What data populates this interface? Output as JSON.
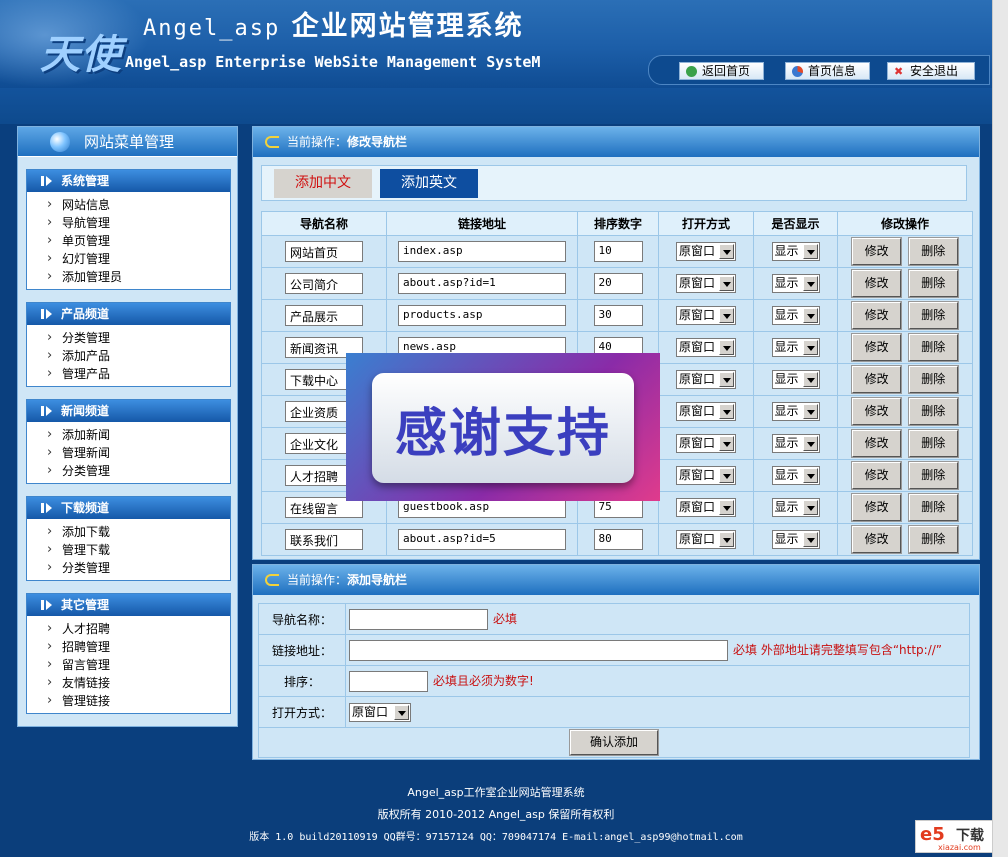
{
  "header": {
    "logo": "天使",
    "title_prefix": "Angel_asp",
    "title_main": "企业网站管理系统",
    "subtitle": "Angel_asp Enterprise WebSite Management SysteM",
    "links": [
      {
        "label": "返回首页",
        "icon": "home-icon"
      },
      {
        "label": "首页信息",
        "icon": "pie-icon"
      },
      {
        "label": "安全退出",
        "icon": "close-icon"
      }
    ]
  },
  "sidebar": {
    "title": "网站菜单管理",
    "groups": [
      {
        "title": "系统管理",
        "items": [
          "网站信息",
          "导航管理",
          "单页管理",
          "幻灯管理",
          "添加管理员"
        ]
      },
      {
        "title": "产品频道",
        "items": [
          "分类管理",
          "添加产品",
          "管理产品"
        ]
      },
      {
        "title": "新闻频道",
        "items": [
          "添加新闻",
          "管理新闻",
          "分类管理"
        ]
      },
      {
        "title": "下载频道",
        "items": [
          "添加下载",
          "管理下载",
          "分类管理"
        ]
      },
      {
        "title": "其它管理",
        "items": [
          "人才招聘",
          "招聘管理",
          "留言管理",
          "友情链接",
          "管理链接"
        ]
      }
    ]
  },
  "edit_panel": {
    "label": "当前操作：",
    "action": "修改导航栏",
    "tabs": [
      "添加中文",
      "添加英文"
    ],
    "columns": [
      "导航名称",
      "链接地址",
      "排序数字",
      "打开方式",
      "是否显示",
      "修改操作"
    ],
    "edit_label": "修改",
    "delete_label": "删除",
    "rows": [
      {
        "name": "网站首页",
        "url": "index.asp",
        "order": "10",
        "open": "原窗口",
        "show": "显示"
      },
      {
        "name": "公司简介",
        "url": "about.asp?id=1",
        "order": "20",
        "open": "原窗口",
        "show": "显示"
      },
      {
        "name": "产品展示",
        "url": "products.asp",
        "order": "30",
        "open": "原窗口",
        "show": "显示"
      },
      {
        "name": "新闻资讯",
        "url": "news.asp",
        "order": "40",
        "open": "原窗口",
        "show": "显示"
      },
      {
        "name": "下载中心",
        "url": "",
        "order": "",
        "open": "原窗口",
        "show": "显示"
      },
      {
        "name": "企业资质",
        "url": "",
        "order": "",
        "open": "原窗口",
        "show": "显示"
      },
      {
        "name": "企业文化",
        "url": "",
        "order": "",
        "open": "原窗口",
        "show": "显示"
      },
      {
        "name": "人才招聘",
        "url": "",
        "order": "",
        "open": "原窗口",
        "show": "显示"
      },
      {
        "name": "在线留言",
        "url": "guestbook.asp",
        "order": "75",
        "open": "原窗口",
        "show": "显示"
      },
      {
        "name": "联系我们",
        "url": "about.asp?id=5",
        "order": "80",
        "open": "原窗口",
        "show": "显示"
      }
    ]
  },
  "add_panel": {
    "label": "当前操作：",
    "action": "添加导航栏",
    "name_label": "导航名称：",
    "name_hint": "必填",
    "url_label": "链接地址：",
    "url_hint": "必填 外部地址请完整填写包含“http://”",
    "order_label": "排序：",
    "order_hint": "必填且必须为数字!",
    "open_label": "打开方式：",
    "open_value": "原窗口",
    "submit": "确认添加"
  },
  "overlay": {
    "text": "感谢支持"
  },
  "footer": {
    "line1": "Angel_asp工作室企业网站管理系统",
    "line2": "版权所有 2010-2012 Angel_asp 保留所有权利",
    "line3": "版本 1.0 build20110919 QQ群号：97157124 QQ：709047174 E-mail:angel_asp99@hotmail.com"
  },
  "watermark": {
    "brand": "e5",
    "text": "下载",
    "url": "xiazai.com"
  },
  "colors": {
    "accent": "#1e6fbf",
    "required": "#c81010",
    "tab_active": "#0e4ea0"
  }
}
